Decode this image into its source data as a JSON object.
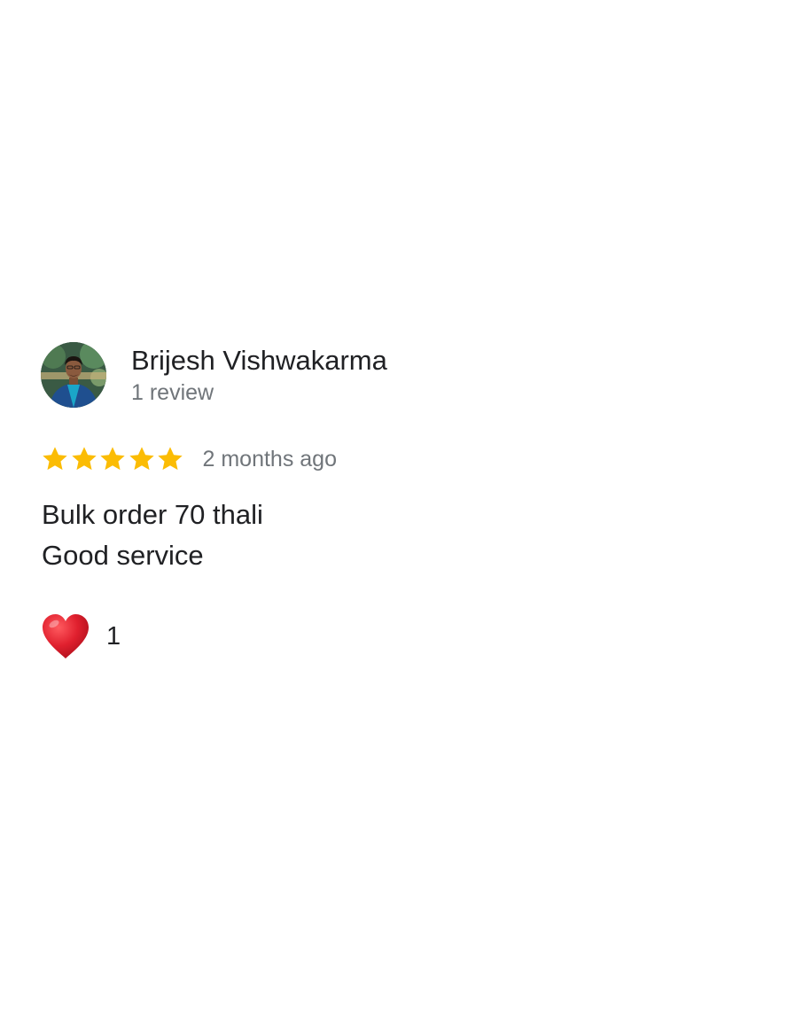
{
  "review": {
    "reviewer_name": "Brijesh Vishwakarma",
    "reviewer_meta": "1 review",
    "rating": 5,
    "rating_max": 5,
    "time_ago": "2 months ago",
    "text_lines": [
      "Bulk order 70 thali",
      "Good service"
    ],
    "reaction": {
      "icon": "heart-icon",
      "count": "1"
    }
  },
  "colors": {
    "star": "#fbbc04",
    "heart": "#e0202e",
    "name_text": "#202124",
    "secondary_text": "#70757a"
  }
}
